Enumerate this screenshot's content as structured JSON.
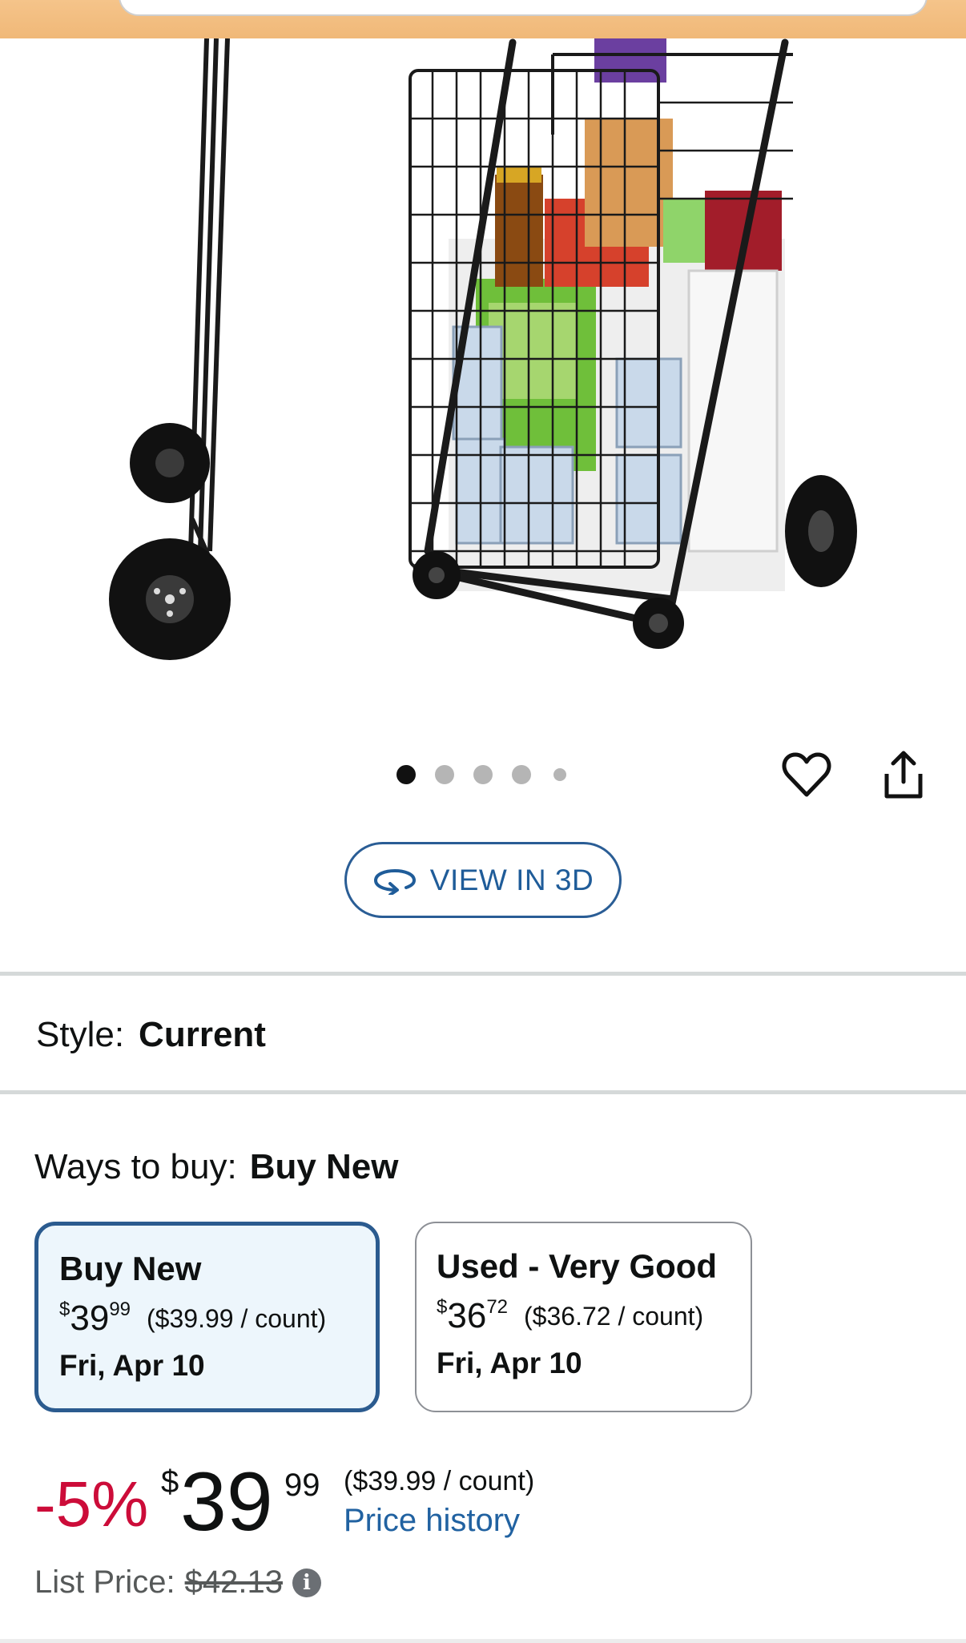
{
  "header": {
    "search_bar_visible": true
  },
  "gallery": {
    "image_alt": "Folding shopping cart with groceries",
    "dot_count": 5,
    "active_dot": 0,
    "favorite_icon": "heart-outline-icon",
    "share_icon": "share-icon"
  },
  "view3d": {
    "label": "VIEW IN 3D",
    "icon": "rotate-3d-icon"
  },
  "style": {
    "label": "Style:",
    "value": "Current"
  },
  "ways_to_buy": {
    "label": "Ways to buy:",
    "value": "Buy New",
    "options": [
      {
        "title": "Buy New",
        "currency": "$",
        "whole": "39",
        "fraction": "99",
        "unit_price": "($39.99 / count)",
        "date": "Fri, Apr 10",
        "selected": true
      },
      {
        "title": "Used - Very Good",
        "currency": "$",
        "whole": "36",
        "fraction": "72",
        "unit_price": "($36.72 / count)",
        "date": "Fri, Apr 10",
        "selected": false
      }
    ]
  },
  "price": {
    "discount": "-5%",
    "currency": "$",
    "whole": "39",
    "fraction": "99",
    "unit_price": "($39.99 / count)",
    "history_link": "Price history",
    "list_price_label": "List Price:",
    "list_price": "$42.13",
    "info_icon": "i"
  },
  "colors": {
    "accent_blue": "#2162a1",
    "selected_border": "#2b5b8f",
    "selected_bg": "#edf6fc",
    "discount_red": "#cc0c39",
    "header_band": "#f0b878"
  }
}
